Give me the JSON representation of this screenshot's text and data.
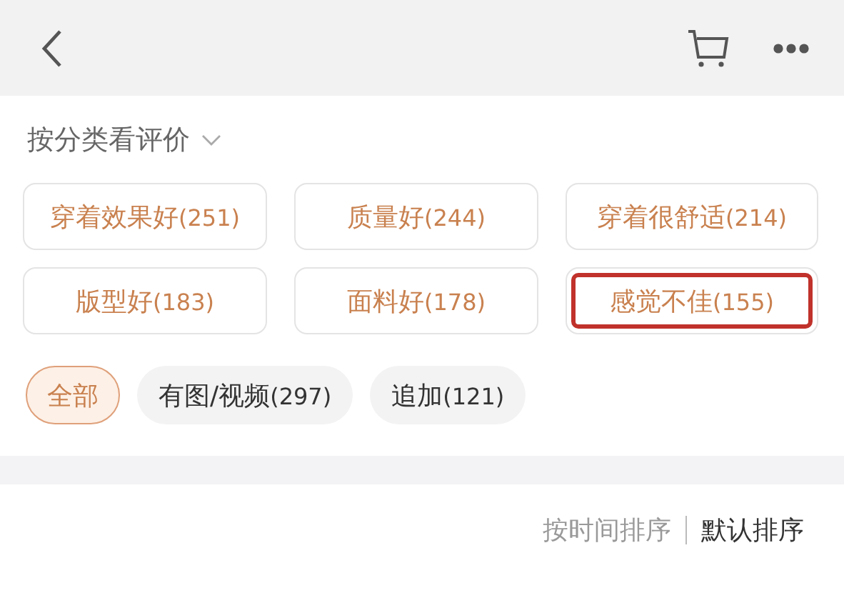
{
  "category": {
    "title": "按分类看评价"
  },
  "tags": [
    {
      "label": "穿着效果好",
      "count": "(251)",
      "highlighted": false
    },
    {
      "label": "质量好",
      "count": "(244)",
      "highlighted": false
    },
    {
      "label": "穿着很舒适",
      "count": "(214)",
      "highlighted": false
    },
    {
      "label": "版型好",
      "count": "(183)",
      "highlighted": false
    },
    {
      "label": "面料好",
      "count": "(178)",
      "highlighted": false
    },
    {
      "label": "感觉不佳",
      "count": "(155)",
      "highlighted": true
    }
  ],
  "filters": [
    {
      "label": "全部",
      "selected": true
    },
    {
      "label": "有图/视频",
      "count": "(297)",
      "selected": false
    },
    {
      "label": "追加",
      "count": "(121)",
      "selected": false
    }
  ],
  "sort": [
    {
      "label": "按时间排序",
      "selected": false
    },
    {
      "label": "默认排序",
      "selected": true
    }
  ]
}
